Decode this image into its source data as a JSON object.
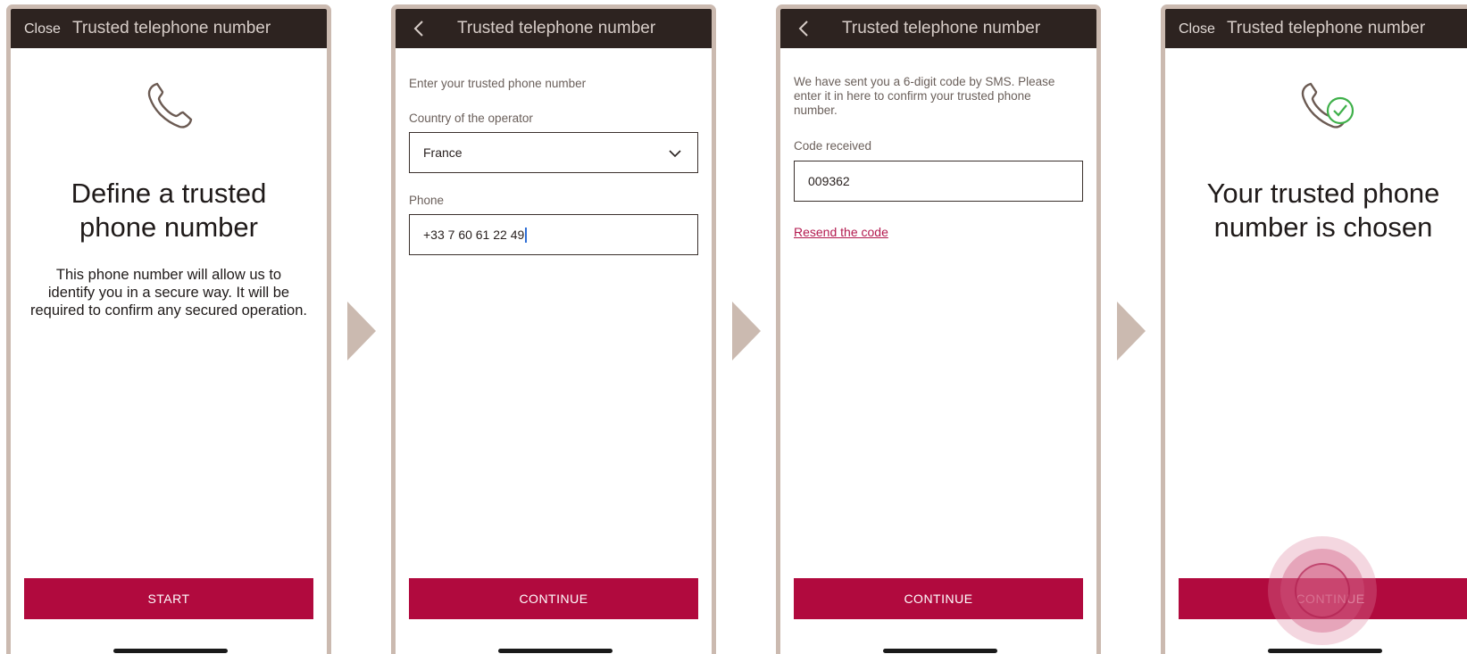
{
  "colors": {
    "accent": "#b10a3e",
    "topbar": "#2d2320",
    "frame": "#cbbab0",
    "link": "#b31a4f",
    "success": "#3fb04a"
  },
  "screen1": {
    "close_label": "Close",
    "title": "Trusted telephone number",
    "icon": "phone-icon",
    "heading_line1": "Define a trusted",
    "heading_line2": "phone number",
    "body_line1": "This phone number will allow us to",
    "body_line2": "identify you in a secure way. It will be",
    "body_line3": "required to confirm any secured operation.",
    "button": "START"
  },
  "screen2": {
    "back_icon": "chevron-left-icon",
    "title": "Trusted telephone number",
    "intro": "Enter your trusted phone number",
    "country_label": "Country of the operator",
    "country_value": "France",
    "phone_label": "Phone",
    "phone_value": "+33 7 60 61 22 49",
    "button": "CONTINUE"
  },
  "screen3": {
    "back_icon": "chevron-left-icon",
    "title": "Trusted telephone number",
    "info_line1": "We have sent you a 6-digit code by SMS. Please",
    "info_line2": "enter it in here to confirm your trusted phone",
    "info_line3": "number.",
    "code_label": "Code received",
    "code_value": "009362",
    "resend_link": "Resend the code",
    "button": "CONTINUE"
  },
  "screen4": {
    "close_label": "Close",
    "title": "Trusted telephone number",
    "icon": "phone-check-icon",
    "heading_line1": "Your trusted phone",
    "heading_line2": "number is chosen",
    "button": "CONTINUE"
  },
  "flow_arrow_icon": "arrow-right-icon"
}
